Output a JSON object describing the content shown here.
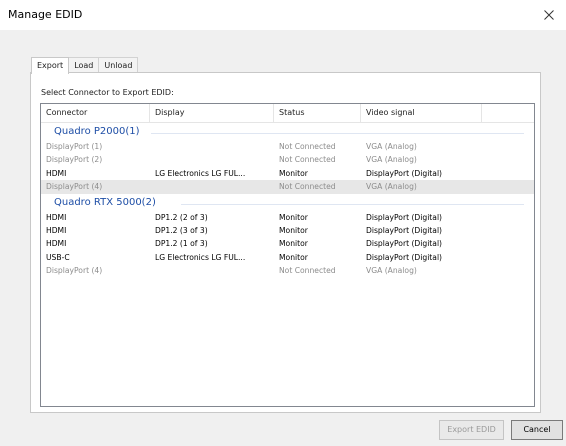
{
  "window": {
    "title": "Manage EDID"
  },
  "tabs": [
    {
      "label": "Export",
      "active": true
    },
    {
      "label": "Load",
      "active": false
    },
    {
      "label": "Unload",
      "active": false
    }
  ],
  "prompt": "Select Connector to Export EDID:",
  "columns": [
    "Connector",
    "Display",
    "Status",
    "Video signal"
  ],
  "groups": [
    {
      "name": "Quadro P2000(1)",
      "rows": [
        {
          "connector": "DisplayPort (1)",
          "display": "",
          "status": "Not Connected",
          "signal": "VGA (Analog)",
          "enabled": false,
          "selected": false
        },
        {
          "connector": "DisplayPort (2)",
          "display": "",
          "status": "Not Connected",
          "signal": "VGA (Analog)",
          "enabled": false,
          "selected": false
        },
        {
          "connector": "HDMI",
          "display": "LG Electronics LG FUL...",
          "status": "Monitor",
          "signal": "DisplayPort (Digital)",
          "enabled": true,
          "selected": false
        },
        {
          "connector": "DisplayPort (4)",
          "display": "",
          "status": "Not Connected",
          "signal": "VGA (Analog)",
          "enabled": false,
          "selected": true
        }
      ]
    },
    {
      "name": "Quadro RTX 5000(2)",
      "rows": [
        {
          "connector": "HDMI",
          "display": "DP1.2 (2 of 3)",
          "status": "Monitor",
          "signal": "DisplayPort (Digital)",
          "enabled": true,
          "selected": false
        },
        {
          "connector": "HDMI",
          "display": "DP1.2 (3 of 3)",
          "status": "Monitor",
          "signal": "DisplayPort (Digital)",
          "enabled": true,
          "selected": false
        },
        {
          "connector": "HDMI",
          "display": "DP1.2 (1 of 3)",
          "status": "Monitor",
          "signal": "DisplayPort (Digital)",
          "enabled": true,
          "selected": false
        },
        {
          "connector": "USB-C",
          "display": "LG Electronics LG FUL...",
          "status": "Monitor",
          "signal": "DisplayPort (Digital)",
          "enabled": true,
          "selected": false
        },
        {
          "connector": "DisplayPort (4)",
          "display": "",
          "status": "Not Connected",
          "signal": "VGA (Analog)",
          "enabled": false,
          "selected": false
        }
      ]
    }
  ],
  "buttons": {
    "export": "Export EDID",
    "cancel": "Cancel"
  },
  "colors": {
    "group_header": "#1e4ea6",
    "disabled_text": "#8c8c8c",
    "selected_row": "#e7e7e7"
  }
}
